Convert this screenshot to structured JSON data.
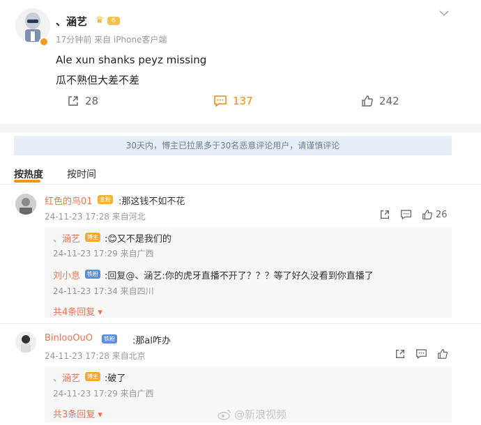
{
  "post": {
    "author": "、涵艺",
    "vip_level": "6",
    "time": "17分钟前",
    "source": "来自 iPhone客户端",
    "line1": "Ale xun shanks peyz missing",
    "line2": "瓜不熟但大差不差",
    "share_count": "28",
    "comment_count": "137",
    "like_count": "242"
  },
  "notice": "30天内，博主已拉黑多于30名恶意评论用户，请谨慎评论",
  "sort": {
    "hot": "按热度",
    "time": "按时间"
  },
  "comments": [
    {
      "name": "红色的鸟01",
      "badge": "金粉",
      "text": ":那这钱不如不花",
      "meta": "24-11-23 17:28 来自河北",
      "likes": "26",
      "replies": [
        {
          "name": "、涵艺",
          "badge": "博主",
          "text": ":😊又不是我们的",
          "meta": "24-11-23 17:29 来自广西"
        },
        {
          "name": "刘小息",
          "badge": "铁粉",
          "text": ":回复@、涵艺:你的虎牙直播不开了？？？等了好久没看到你直播了",
          "meta": "24-11-23 17:34 来自四川"
        }
      ],
      "more": "共4条回复"
    },
    {
      "name": "BinlooOuO",
      "badge": "铁粉",
      "text": ":那al咋办",
      "meta": "24-11-23 17:28 来自北京",
      "likes": "",
      "replies": [
        {
          "name": "、涵艺",
          "badge": "博主",
          "text": ":破了",
          "meta": "24-11-23 17:29 来自广西"
        }
      ],
      "more": "共3条回复"
    }
  ],
  "watermark": "@新浪视频",
  "colors": {
    "accent": "#f08a00",
    "name": "#eb7350",
    "notice_bg": "#e6eef8"
  }
}
